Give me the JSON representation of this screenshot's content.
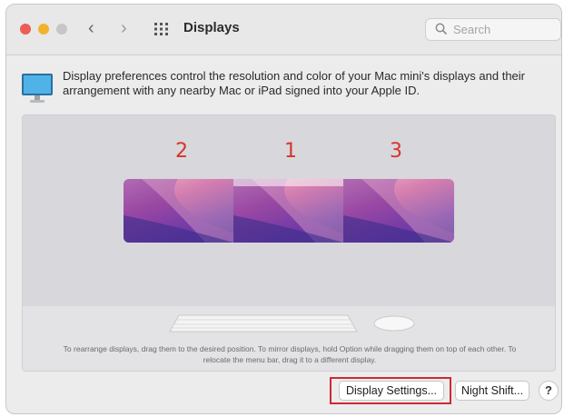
{
  "window": {
    "title": "Displays",
    "nav_back": "‹",
    "nav_forward": "›",
    "search_placeholder": "Search"
  },
  "description": "Display preferences control the resolution and color of your Mac mini's displays and their arrangement with any nearby Mac or iPad signed into your Apple ID.",
  "arrangement": {
    "displays": [
      {
        "number": "2"
      },
      {
        "number": "1"
      },
      {
        "number": "3"
      }
    ],
    "hint": "To rearrange displays, drag them to the desired position. To mirror displays, hold Option while dragging them on top of each other. To relocate the menu bar, drag it to a different display."
  },
  "buttons": {
    "display_settings": "Display Settings...",
    "night_shift": "Night Shift...",
    "help": "?"
  },
  "colors": {
    "highlight_box": "#cc2a35",
    "display_number": "#d8342a",
    "close": "#ef5b57",
    "minimize": "#f3b22c"
  }
}
